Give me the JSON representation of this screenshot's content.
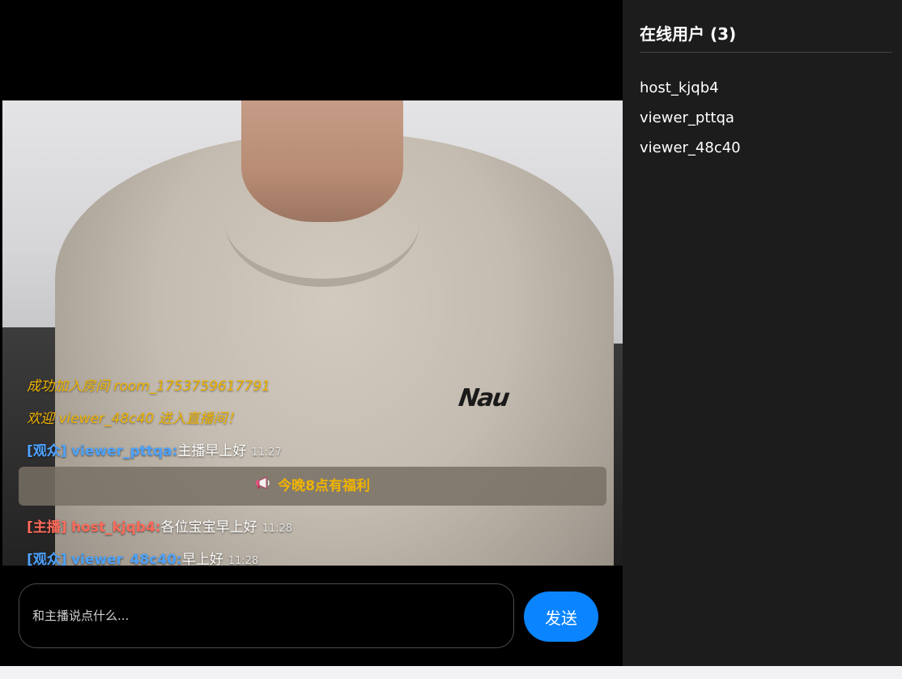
{
  "chat": {
    "system_messages": [
      "成功加入房间 room_1753759617791",
      "欢迎 viewer_48c40 进入直播间！"
    ],
    "messages": [
      {
        "role": "[观众]",
        "user": "viewer_pttqa:",
        "text": "主播早上好",
        "time": "11:27",
        "role_type": "viewer"
      },
      {
        "role": "[主播]",
        "user": "host_kjqb4:",
        "text": "各位宝宝早上好",
        "time": "11:28",
        "role_type": "host"
      },
      {
        "role": "[观众]",
        "user": "viewer_48c40:",
        "text": "早上好",
        "time": "11:28",
        "role_type": "viewer"
      }
    ],
    "announcement": {
      "icon": "megaphone-icon",
      "text": "今晚8点有福利"
    }
  },
  "video": {
    "shirt_logo": "Nau"
  },
  "composer": {
    "placeholder": "和主播说点什么...",
    "send_label": "发送"
  },
  "sidebar": {
    "title": "在线用户 (3)",
    "users": [
      "host_kjqb4",
      "viewer_pttqa",
      "viewer_48c40"
    ]
  },
  "colors": {
    "system_text": "#f0b400",
    "viewer_role": "#4da3ff",
    "host_role": "#ff6b5b",
    "send_button": "#0a84ff",
    "sidebar_bg": "#1c1c1c"
  }
}
